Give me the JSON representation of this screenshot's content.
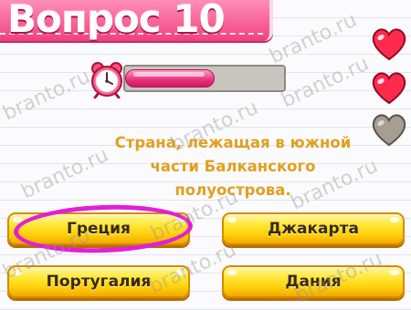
{
  "header": {
    "title": "Вопрос 10"
  },
  "timer": {
    "remaining_fraction": 0.57,
    "fill_color": "#e8307b"
  },
  "lives": [
    {
      "state": "full",
      "color": "#ff2b4d"
    },
    {
      "state": "full",
      "color": "#ff2b4d"
    },
    {
      "state": "empty",
      "color": "#a79e92"
    }
  ],
  "question": {
    "text": "Страна, лежащая в южной части Балканского полуострова."
  },
  "answers": [
    {
      "label": "Греция",
      "selected": true
    },
    {
      "label": "Джакарта",
      "selected": false
    },
    {
      "label": "Португалия",
      "selected": false
    },
    {
      "label": "Дания",
      "selected": false
    }
  ],
  "colors": {
    "header": "#f0417d",
    "question_text": "#e0a021",
    "answer_button": "#ffd21a",
    "highlight_ring": "#e11fd6"
  },
  "watermark": "branto.ru"
}
